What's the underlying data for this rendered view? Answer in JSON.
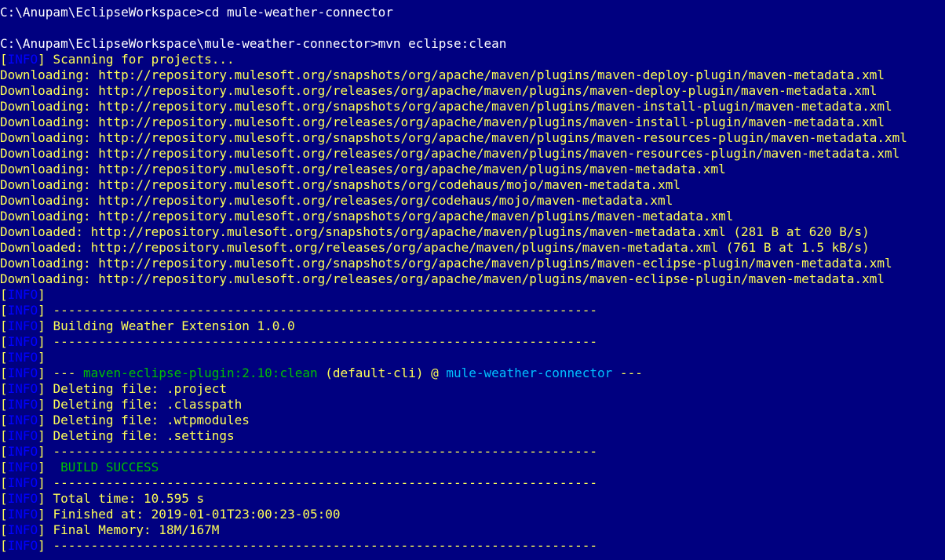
{
  "terminal": {
    "lines": [
      {
        "type": "cmd",
        "text": "C:\\Anupam\\EclipseWorkspace>cd mule-weather-connector"
      },
      {
        "type": "blank",
        "text": ""
      },
      {
        "type": "cmd",
        "text": "C:\\Anupam\\EclipseWorkspace\\mule-weather-connector>mvn eclipse:clean"
      },
      {
        "type": "info",
        "text": " Scanning for projects..."
      },
      {
        "type": "plain",
        "text": "Downloading: http://repository.mulesoft.org/snapshots/org/apache/maven/plugins/maven-deploy-plugin/maven-metadata.xml"
      },
      {
        "type": "plain",
        "text": "Downloading: http://repository.mulesoft.org/releases/org/apache/maven/plugins/maven-deploy-plugin/maven-metadata.xml"
      },
      {
        "type": "plain",
        "text": "Downloading: http://repository.mulesoft.org/snapshots/org/apache/maven/plugins/maven-install-plugin/maven-metadata.xml"
      },
      {
        "type": "plain",
        "text": "Downloading: http://repository.mulesoft.org/releases/org/apache/maven/plugins/maven-install-plugin/maven-metadata.xml"
      },
      {
        "type": "plain",
        "text": "Downloading: http://repository.mulesoft.org/snapshots/org/apache/maven/plugins/maven-resources-plugin/maven-metadata.xml"
      },
      {
        "type": "plain",
        "text": "Downloading: http://repository.mulesoft.org/releases/org/apache/maven/plugins/maven-resources-plugin/maven-metadata.xml"
      },
      {
        "type": "plain",
        "text": "Downloading: http://repository.mulesoft.org/releases/org/apache/maven/plugins/maven-metadata.xml"
      },
      {
        "type": "plain",
        "text": "Downloading: http://repository.mulesoft.org/snapshots/org/codehaus/mojo/maven-metadata.xml"
      },
      {
        "type": "plain",
        "text": "Downloading: http://repository.mulesoft.org/releases/org/codehaus/mojo/maven-metadata.xml"
      },
      {
        "type": "plain",
        "text": "Downloading: http://repository.mulesoft.org/snapshots/org/apache/maven/plugins/maven-metadata.xml"
      },
      {
        "type": "plain",
        "text": "Downloaded: http://repository.mulesoft.org/snapshots/org/apache/maven/plugins/maven-metadata.xml (281 B at 620 B/s)"
      },
      {
        "type": "plain",
        "text": "Downloaded: http://repository.mulesoft.org/releases/org/apache/maven/plugins/maven-metadata.xml (761 B at 1.5 kB/s)"
      },
      {
        "type": "plain",
        "text": "Downloading: http://repository.mulesoft.org/snapshots/org/apache/maven/plugins/maven-eclipse-plugin/maven-metadata.xml"
      },
      {
        "type": "plain",
        "text": "Downloading: http://repository.mulesoft.org/releases/org/apache/maven/plugins/maven-eclipse-plugin/maven-metadata.xml"
      },
      {
        "type": "info",
        "text": ""
      },
      {
        "type": "info",
        "text": " ------------------------------------------------------------------------"
      },
      {
        "type": "info",
        "text": " Building Weather Extension 1.0.0"
      },
      {
        "type": "info",
        "text": " ------------------------------------------------------------------------"
      },
      {
        "type": "info",
        "text": ""
      },
      {
        "type": "mojo",
        "prefix": " --- ",
        "plugin": "maven-eclipse-plugin:2.10:clean",
        "middle": " (default-cli) @ ",
        "artifact": "mule-weather-connector",
        "suffix": " ---"
      },
      {
        "type": "info",
        "text": " Deleting file: .project"
      },
      {
        "type": "info",
        "text": " Deleting file: .classpath"
      },
      {
        "type": "info",
        "text": " Deleting file: .wtpmodules"
      },
      {
        "type": "info",
        "text": " Deleting file: .settings"
      },
      {
        "type": "info",
        "text": " ------------------------------------------------------------------------"
      },
      {
        "type": "success",
        "text": " BUILD SUCCESS"
      },
      {
        "type": "info",
        "text": " ------------------------------------------------------------------------"
      },
      {
        "type": "info",
        "text": " Total time: 10.595 s"
      },
      {
        "type": "info",
        "text": " Finished at: 2019-01-01T23:00:23-05:00"
      },
      {
        "type": "info",
        "text": " Final Memory: 18M/167M"
      },
      {
        "type": "info",
        "text": " ------------------------------------------------------------------------"
      }
    ],
    "info_label": "INFO"
  },
  "colors": {
    "background": "#000080",
    "default_text": "#ffff55",
    "command_text": "#ffffff",
    "info_tag": "#0000ff",
    "plugin_text": "#00c000",
    "artifact_text": "#00c0ff",
    "success_text": "#00c000"
  }
}
